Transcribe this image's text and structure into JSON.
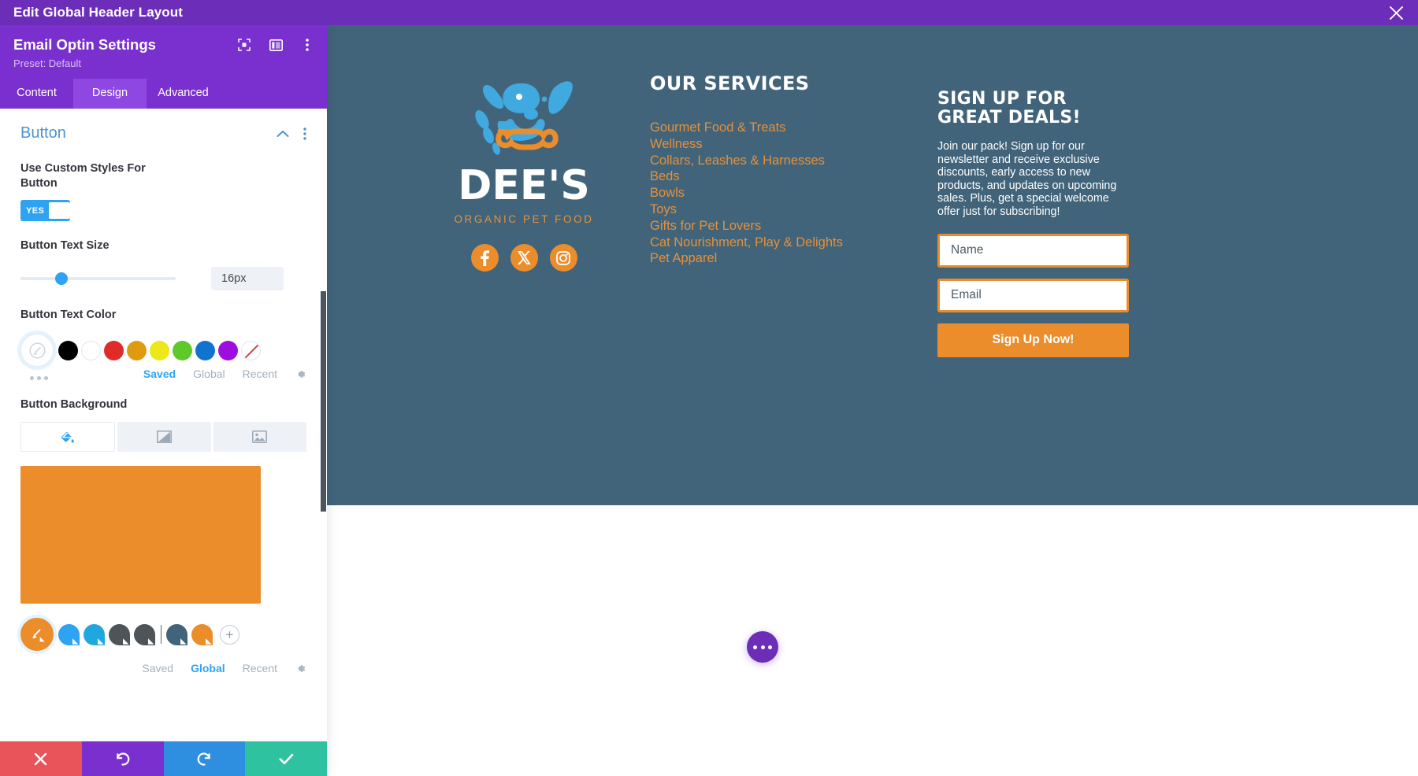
{
  "window": {
    "title": "Edit Global Header Layout",
    "close_icon": "close-icon"
  },
  "panel": {
    "title": "Email Optin Settings",
    "preset": "Preset: Default",
    "header_icons": [
      "focus-target-icon",
      "layout-columns-icon",
      "kebab-menu-icon"
    ],
    "tabs": [
      {
        "label": "Content",
        "active": false
      },
      {
        "label": "Design",
        "active": true
      },
      {
        "label": "Advanced",
        "active": false
      }
    ],
    "section": {
      "title": "Button",
      "collapse_icon": "chevron-up-icon",
      "menu_icon": "kebab-menu-icon"
    },
    "custom_styles": {
      "label": "Use Custom Styles For Button",
      "toggle_value": "YES"
    },
    "text_size": {
      "label": "Button Text Size",
      "value": "16px",
      "slider_percent": 25
    },
    "text_color": {
      "label": "Button Text Color",
      "picker_icon": "eyedropper-icon",
      "swatches": [
        "#000000",
        "#ffffff",
        "#e02b2b",
        "#e09a10",
        "#ece81a",
        "#5ec92a",
        "#1273ce",
        "#9d0de0"
      ],
      "no_color_icon": "no-color-icon",
      "more_icon": "more-dots-icon",
      "tabs": [
        {
          "label": "Saved",
          "active": true
        },
        {
          "label": "Global",
          "active": false
        },
        {
          "label": "Recent",
          "active": false
        }
      ],
      "settings_icon": "gear-icon"
    },
    "background": {
      "label": "Button Background",
      "type_tabs": [
        {
          "icon": "paint-bucket-icon",
          "active": true
        },
        {
          "icon": "gradient-icon",
          "active": false
        },
        {
          "icon": "image-icon",
          "active": false
        }
      ],
      "preview_color": "#ec8d2b",
      "picker_icon": "eyedropper-icon",
      "global_swatches": [
        "#2ea3f2",
        "#21a7e0",
        "#4f5458",
        "#4f5458",
        "#41647a",
        "#ec8d2b"
      ],
      "add_icon": "plus-icon",
      "tabs": [
        {
          "label": "Saved",
          "active": false
        },
        {
          "label": "Global",
          "active": true
        },
        {
          "label": "Recent",
          "active": false
        }
      ],
      "settings_icon": "gear-icon"
    },
    "footer": [
      {
        "name": "cancel",
        "icon": "x-icon",
        "color": "#e8545a"
      },
      {
        "name": "undo",
        "icon": "undo-icon",
        "color": "#7a2fcf"
      },
      {
        "name": "redo",
        "icon": "redo-icon",
        "color": "#2e8fe0"
      },
      {
        "name": "save",
        "icon": "check-icon",
        "color": "#2fc2a0"
      }
    ]
  },
  "preview": {
    "background_color": "#41647a",
    "accent_color": "#ec8d2b",
    "logo": {
      "wordmark": "DEE'S",
      "tagline": "ORGANIC PET FOOD",
      "mark_icon": "dog-face-icon"
    },
    "social": [
      {
        "name": "facebook-icon",
        "glyph": "f"
      },
      {
        "name": "x-twitter-icon",
        "glyph": "X"
      },
      {
        "name": "instagram-icon",
        "glyph": "in"
      }
    ],
    "services": {
      "heading": "OUR SERVICES",
      "items": [
        "Gourmet Food & Treats",
        "Wellness",
        "Collars, Leashes & Harnesses",
        "Beds",
        "Bowls",
        "Toys",
        "Gifts for Pet Lovers",
        "Cat Nourishment, Play & Delights",
        "Pet Apparel"
      ]
    },
    "optin": {
      "heading": "SIGN UP FOR GREAT DEALS!",
      "body": "Join our pack! Sign up for our newsletter and receive exclusive discounts, early access to new products, and updates on upcoming sales. Plus, get a special welcome offer just for subscribing!",
      "name_placeholder": "Name",
      "email_placeholder": "Email",
      "button_label": "Sign Up Now!"
    },
    "fab_icon": "more-options-icon"
  }
}
